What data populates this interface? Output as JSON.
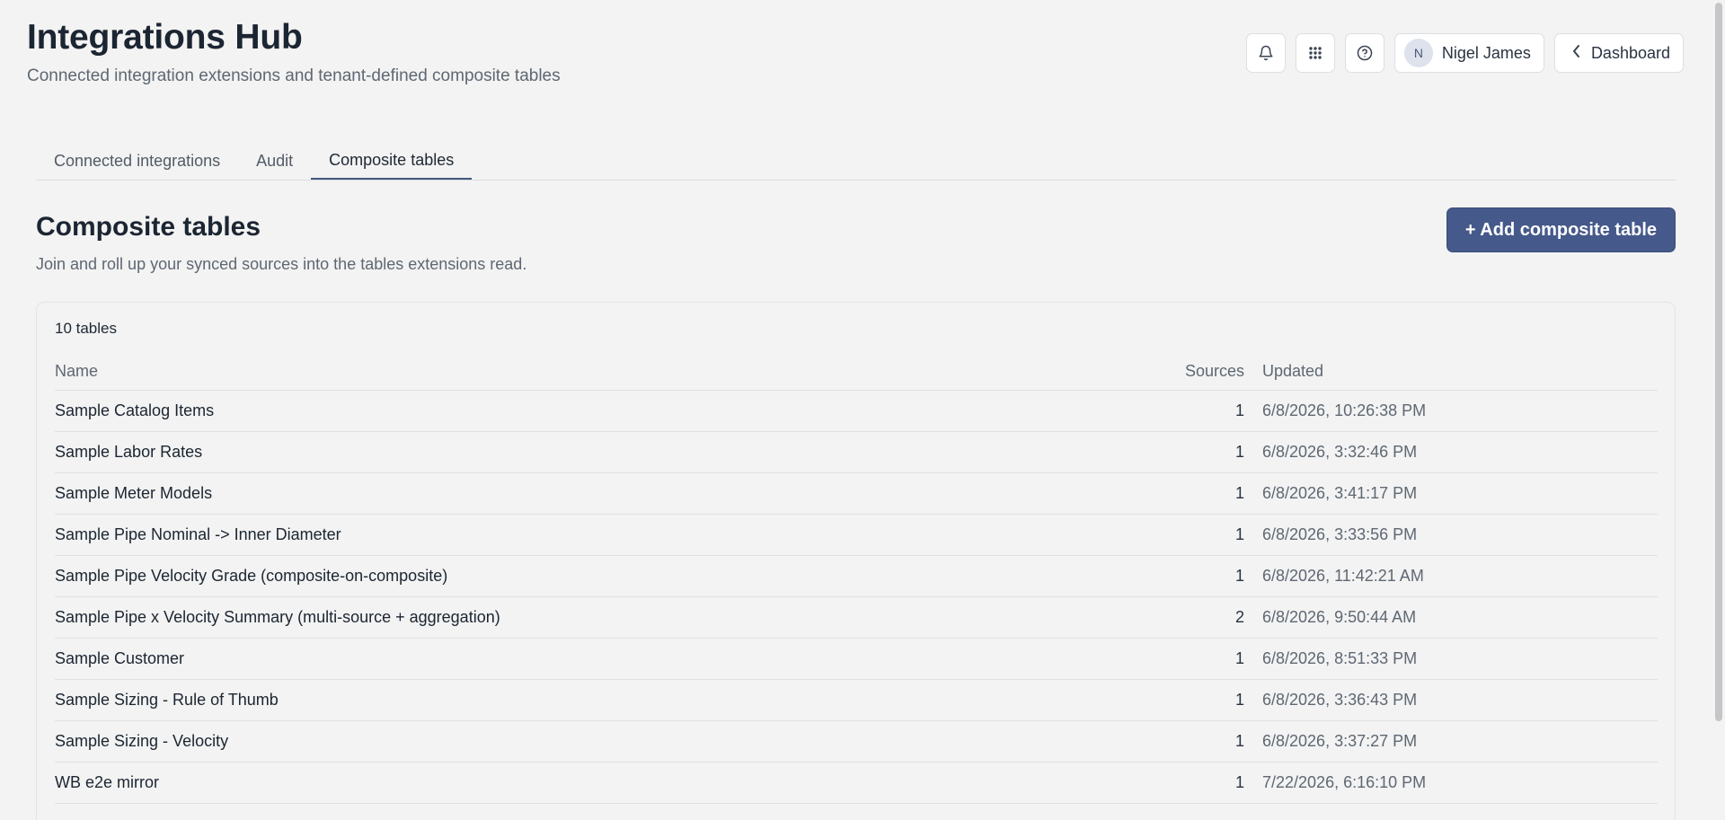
{
  "header": {
    "title": "Integrations Hub",
    "subtitle": "Connected integration extensions and tenant-defined composite tables"
  },
  "top_actions": {
    "icons": [
      "bell-icon",
      "grid-icon",
      "help-icon"
    ],
    "user": {
      "initial": "N",
      "name": "Nigel James"
    },
    "dashboard_label": "Dashboard"
  },
  "tabs": [
    {
      "label": "Connected integrations",
      "active": false
    },
    {
      "label": "Audit",
      "active": false
    },
    {
      "label": "Composite tables",
      "active": true
    }
  ],
  "section": {
    "title": "Composite tables",
    "description": "Join and roll up your synced sources into the tables extensions read.",
    "add_button_label": "+ Add composite table"
  },
  "table": {
    "count_label": "10 tables",
    "columns": {
      "name": "Name",
      "sources": "Sources",
      "updated": "Updated"
    },
    "rows": [
      {
        "name": "Sample Catalog Items",
        "sources": "1",
        "updated": "6/8/2026, 10:26:38 PM"
      },
      {
        "name": "Sample Labor Rates",
        "sources": "1",
        "updated": "6/8/2026, 3:32:46 PM"
      },
      {
        "name": "Sample Meter Models",
        "sources": "1",
        "updated": "6/8/2026, 3:41:17 PM"
      },
      {
        "name": "Sample Pipe Nominal -> Inner Diameter",
        "sources": "1",
        "updated": "6/8/2026, 3:33:56 PM"
      },
      {
        "name": "Sample Pipe Velocity Grade (composite-on-composite)",
        "sources": "1",
        "updated": "6/8/2026, 11:42:21 AM"
      },
      {
        "name": "Sample Pipe x Velocity Summary (multi-source + aggregation)",
        "sources": "2",
        "updated": "6/8/2026, 9:50:44 AM"
      },
      {
        "name": "Sample Customer",
        "sources": "1",
        "updated": "6/8/2026, 8:51:33 PM"
      },
      {
        "name": "Sample Sizing - Rule of Thumb",
        "sources": "1",
        "updated": "6/8/2026, 3:36:43 PM"
      },
      {
        "name": "Sample Sizing - Velocity",
        "sources": "1",
        "updated": "6/8/2026, 3:37:27 PM"
      },
      {
        "name": "WB e2e mirror",
        "sources": "1",
        "updated": "7/22/2026, 6:16:10 PM"
      }
    ]
  },
  "colors": {
    "accent": "#45598a",
    "background": "#f2f3f2",
    "tab_underline": "#43587f"
  }
}
